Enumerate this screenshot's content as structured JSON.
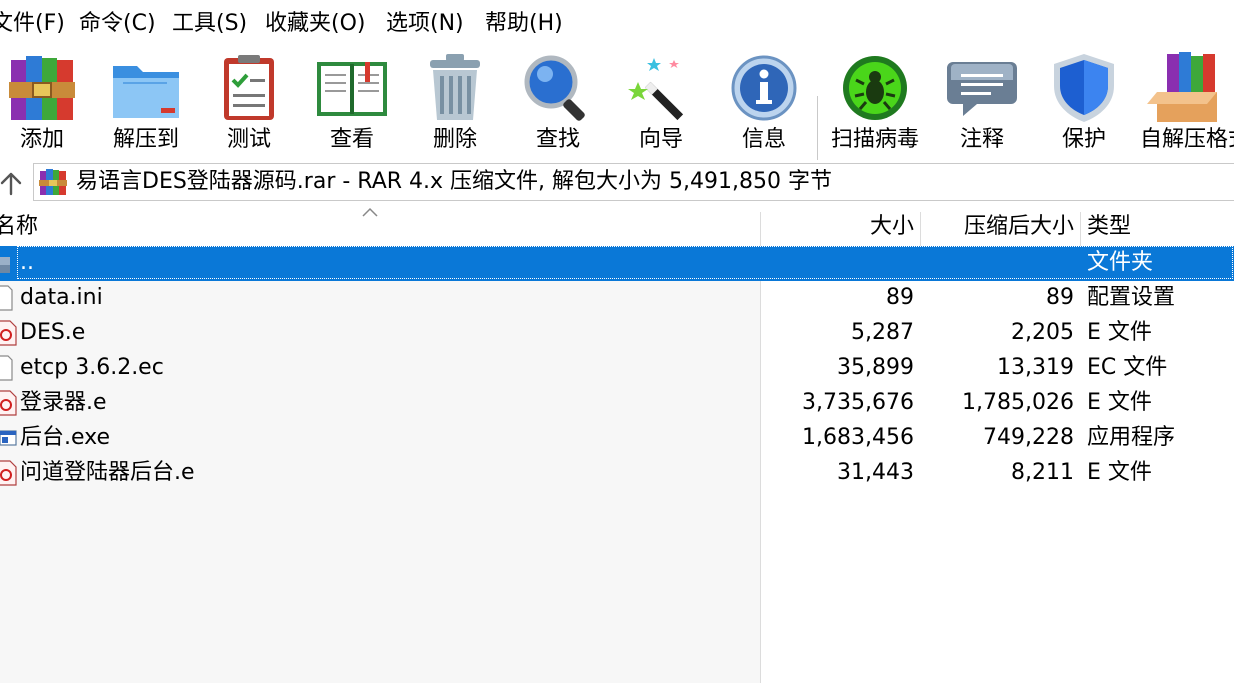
{
  "menu": [
    "文件(F)",
    "命令(C)",
    "工具(S)",
    "收藏夹(O)",
    "选项(N)",
    "帮助(H)"
  ],
  "toolbar": {
    "add": "添加",
    "extract_to": "解压到",
    "test": "测试",
    "view": "查看",
    "delete": "删除",
    "find": "查找",
    "wizard": "向导",
    "info": "信息",
    "virus_scan": "扫描病毒",
    "comment": "注释",
    "protect": "保护",
    "sfx": "自解压格式"
  },
  "address": {
    "text": "易语言DES登陆器源码.rar - RAR 4.x 压缩文件, 解包大小为 5,491,850 字节"
  },
  "columns": {
    "name": "名称",
    "size": "大小",
    "packed": "压缩后大小",
    "type": "类型"
  },
  "files": [
    {
      "name": "..",
      "size": "",
      "packed": "",
      "type": "文件夹",
      "icon": "folder-up-icon"
    },
    {
      "name": "data.ini",
      "size": "89",
      "packed": "89",
      "type": "配置设置",
      "icon": "generic-file-icon"
    },
    {
      "name": "DES.e",
      "size": "5,287",
      "packed": "2,205",
      "type": "E 文件",
      "icon": "e-file-icon"
    },
    {
      "name": "etcp 3.6.2.ec",
      "size": "35,899",
      "packed": "13,319",
      "type": "EC 文件",
      "icon": "generic-file-icon"
    },
    {
      "name": "登录器.e",
      "size": "3,735,676",
      "packed": "1,785,026",
      "type": "E 文件",
      "icon": "e-file-icon"
    },
    {
      "name": "后台.exe",
      "size": "1,683,456",
      "packed": "749,228",
      "type": "应用程序",
      "icon": "exe-file-icon"
    },
    {
      "name": "问道登陆器后台.e",
      "size": "31,443",
      "packed": "8,211",
      "type": "E 文件",
      "icon": "e-file-icon"
    }
  ],
  "colors": {
    "selection": "#0a78d7",
    "name_pane": "#f7f7f7"
  }
}
